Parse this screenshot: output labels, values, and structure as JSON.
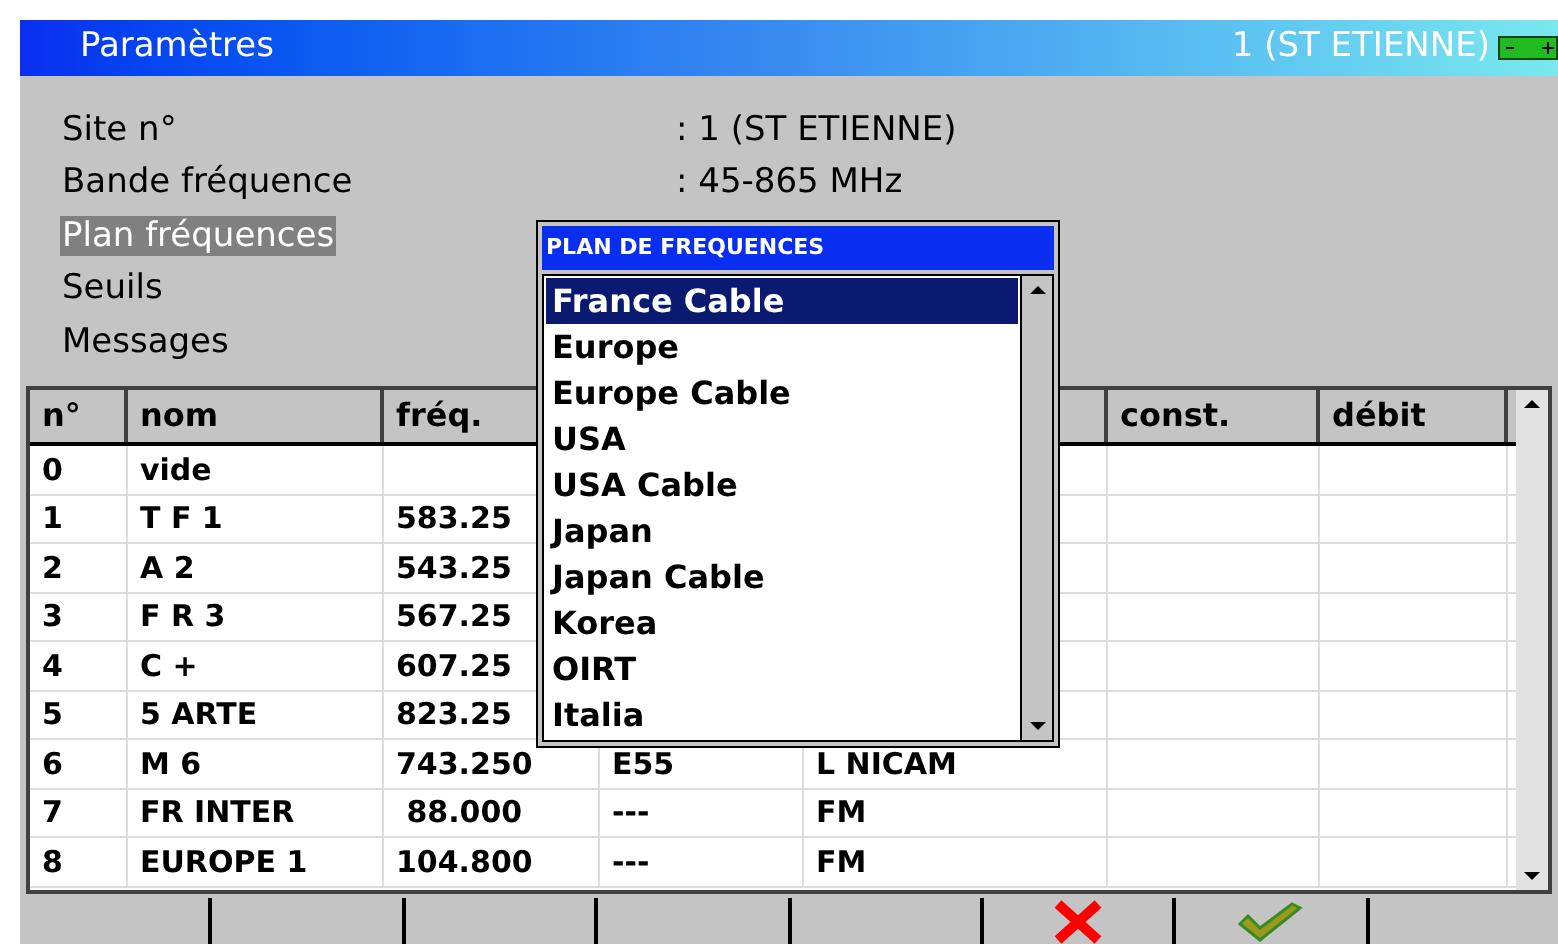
{
  "window": {
    "title": "Paramètres",
    "site_badge": "1 (ST ETIENNE)"
  },
  "settings": [
    {
      "label": "Site n°",
      "value": ": 1  (ST ETIENNE)",
      "selected": false
    },
    {
      "label": "Bande fréquence",
      "value": ": 45-865 MHz",
      "selected": false
    },
    {
      "label": "Plan fréquences",
      "selected": true
    },
    {
      "label": "Seuils",
      "selected": false
    },
    {
      "label": "Messages",
      "selected": false
    }
  ],
  "table": {
    "columns": [
      "n°",
      "nom",
      "fréq.",
      "const.",
      "débit"
    ],
    "rows": [
      {
        "n": "0",
        "nom": "vide"
      },
      {
        "n": "1",
        "nom": "T F 1",
        "freq": "583.25"
      },
      {
        "n": "2",
        "nom": "A 2",
        "freq": "543.25"
      },
      {
        "n": "3",
        "nom": "F R 3",
        "freq": "567.25"
      },
      {
        "n": "4",
        "nom": "C +",
        "freq": "607.25"
      },
      {
        "n": "5",
        "nom": "5 ARTE",
        "freq": "823.25"
      },
      {
        "n": "6",
        "nom": "M 6",
        "freq": "743.250",
        "column_4": "E55",
        "column_5": "L NICAM"
      },
      {
        "n": "7",
        "nom": "FR INTER",
        "freq": " 88.000",
        "column_4": "---",
        "column_5": "FM"
      },
      {
        "n": "8",
        "nom": "EUROPE 1",
        "freq": "104.800",
        "column_4": "---",
        "column_5": "FM"
      }
    ]
  },
  "popup": {
    "title": "PLAN DE FREQUENCES",
    "items": [
      {
        "label": "France Cable",
        "selected": true
      },
      {
        "label": "Europe",
        "selected": false
      },
      {
        "label": "Europe Cable",
        "selected": false
      },
      {
        "label": "USA",
        "selected": false
      },
      {
        "label": "USA Cable",
        "selected": false
      },
      {
        "label": "Japan",
        "selected": false
      },
      {
        "label": "Japan Cable",
        "selected": false
      },
      {
        "label": "Korea",
        "selected": false
      },
      {
        "label": "OIRT",
        "selected": false
      },
      {
        "label": "Italia",
        "selected": false
      }
    ]
  },
  "softkeys": [
    {
      "kind": "blank"
    },
    {
      "kind": "blank"
    },
    {
      "kind": "blank"
    },
    {
      "kind": "blank"
    },
    {
      "kind": "blank"
    },
    {
      "kind": "cancel"
    },
    {
      "kind": "confirm"
    },
    {
      "kind": "blank"
    }
  ]
}
